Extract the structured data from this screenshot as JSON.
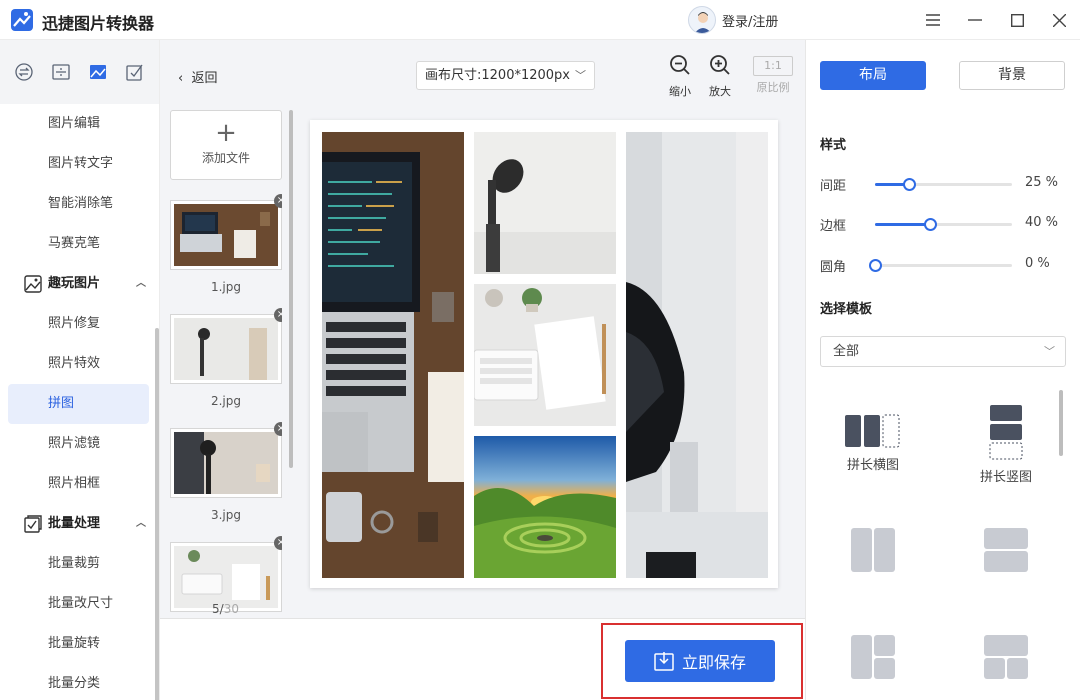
{
  "app": {
    "title": "迅捷图片转换器",
    "login_label": "登录/注册"
  },
  "window_controls": [
    "menu-icon",
    "minimize-icon",
    "maximize-icon",
    "close-icon"
  ],
  "sidebar": {
    "tabs": [
      "convert-icon",
      "cut-icon",
      "picture-icon",
      "edit-icon"
    ],
    "items": [
      {
        "label": "图片编辑"
      },
      {
        "label": "图片转文字"
      },
      {
        "label": "智能消除笔"
      },
      {
        "label": "马赛克笔"
      }
    ],
    "group_fun": {
      "label": "趣玩图片",
      "items": [
        {
          "label": "照片修复"
        },
        {
          "label": "照片特效"
        },
        {
          "label": "拼图",
          "active": true
        },
        {
          "label": "照片滤镜"
        },
        {
          "label": "照片相框"
        }
      ]
    },
    "group_batch": {
      "label": "批量处理",
      "items": [
        {
          "label": "批量裁剪"
        },
        {
          "label": "批量改尺寸"
        },
        {
          "label": "批量旋转"
        },
        {
          "label": "批量分类"
        }
      ]
    }
  },
  "toolbar": {
    "back_label": "返回",
    "canvas_size": "画布尺寸:1200*1200px",
    "zoom_out_label": "缩小",
    "zoom_in_label": "放大",
    "ratio_value": "1:1",
    "ratio_label": "原比例"
  },
  "files": {
    "add_label": "添加文件",
    "items": [
      {
        "name": "1.jpg"
      },
      {
        "name": "2.jpg"
      },
      {
        "name": "3.jpg"
      },
      {
        "name": ""
      }
    ],
    "current": "5/",
    "total": "30"
  },
  "save_button": {
    "label": "立即保存"
  },
  "right_panel": {
    "tab_layout": "布局",
    "tab_background": "背景",
    "style_title": "样式",
    "sliders": [
      {
        "label": "间距",
        "value": 25,
        "display": "25  %"
      },
      {
        "label": "边框",
        "value": 40,
        "display": "40  %"
      },
      {
        "label": "圆角",
        "value": 0,
        "display": "0  %"
      }
    ],
    "template_title": "选择模板",
    "template_filter": "全部",
    "templates": [
      {
        "label": "拼长横图"
      },
      {
        "label": "拼长竖图"
      },
      {
        "label": ""
      },
      {
        "label": ""
      },
      {
        "label": ""
      },
      {
        "label": ""
      }
    ]
  },
  "colors": {
    "accent": "#2f6be4",
    "highlight_border": "#d93030"
  }
}
